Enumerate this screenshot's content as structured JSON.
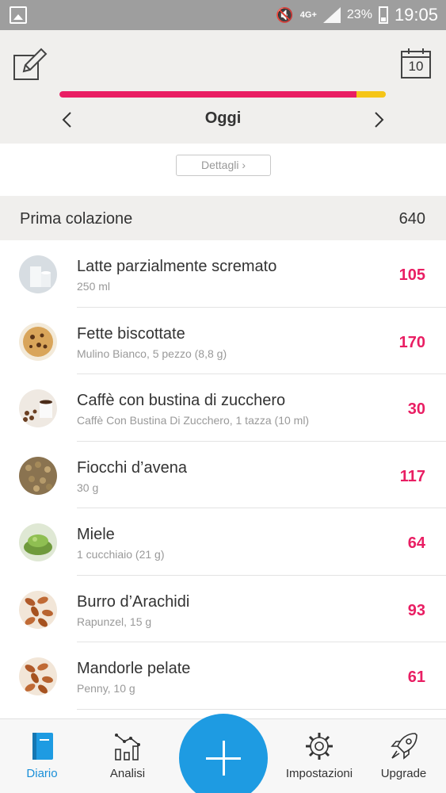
{
  "status_bar": {
    "network": "4G+",
    "battery": "23%",
    "time": "19:05"
  },
  "header": {
    "day_label": "Oggi",
    "calendar_day": "10",
    "progress_fraction": 0.91,
    "overflow_fraction": 0.09,
    "colors": {
      "progress": "#e91e63",
      "overflow": "#f5c518"
    }
  },
  "details_button": "Dettagli ›",
  "meal": {
    "title": "Prima colazione",
    "total": "640"
  },
  "foods": [
    {
      "name": "Latte parzialmente scremato",
      "detail": "250 ml",
      "kcal": "105",
      "icon": "milk-icon"
    },
    {
      "name": "Fette biscottate",
      "detail": "Mulino Bianco, 5 pezzo (8,8 g)",
      "kcal": "170",
      "icon": "cookie-icon"
    },
    {
      "name": "Caffè con bustina di zucchero",
      "detail": "Caffè Con Bustina Di Zucchero, 1 tazza (10 ml)",
      "kcal": "30",
      "icon": "coffee-icon"
    },
    {
      "name": "Fiocchi d’avena",
      "detail": "30 g",
      "kcal": "117",
      "icon": "oats-icon"
    },
    {
      "name": "Miele",
      "detail": "1 cucchiaio (21 g)",
      "kcal": "64",
      "icon": "honey-icon"
    },
    {
      "name": "Burro d’Arachidi",
      "detail": "Rapunzel, 15 g",
      "kcal": "93",
      "icon": "almonds-icon"
    },
    {
      "name": "Mandorle pelate",
      "detail": "Penny, 10 g",
      "kcal": "61",
      "icon": "almonds-icon"
    }
  ],
  "bottom_nav": {
    "items": [
      {
        "label": "Diario",
        "icon": "diary-icon",
        "active": true
      },
      {
        "label": "Analisi",
        "icon": "analysis-icon",
        "active": false
      },
      {
        "label": "Impostazioni",
        "icon": "settings-gear-icon",
        "active": false
      },
      {
        "label": "Upgrade",
        "icon": "rocket-icon",
        "active": false
      }
    ],
    "accent": "#1e9be2"
  }
}
